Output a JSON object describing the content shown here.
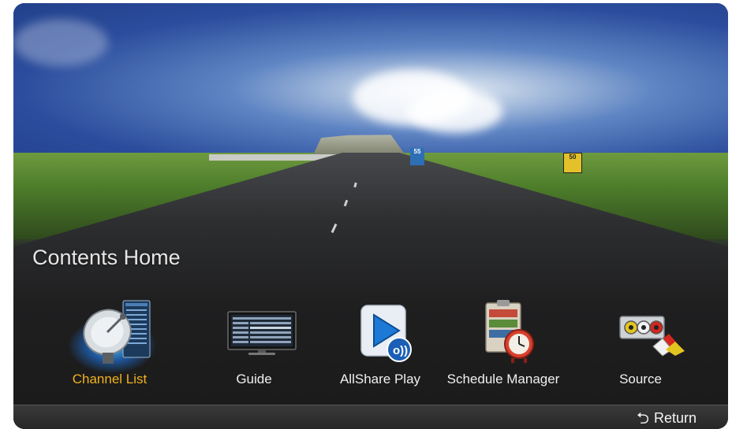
{
  "screen": {
    "title": "Contents Home"
  },
  "menu": {
    "items": [
      {
        "label": "Channel List",
        "icon": "satellite-dish-icon",
        "selected": true
      },
      {
        "label": "Guide",
        "icon": "tv-guide-icon",
        "selected": false
      },
      {
        "label": "AllShare Play",
        "icon": "allshare-play-icon",
        "selected": false
      },
      {
        "label": "Schedule Manager",
        "icon": "schedule-clock-icon",
        "selected": false
      },
      {
        "label": "Source",
        "icon": "av-source-icon",
        "selected": false
      }
    ]
  },
  "scene": {
    "exit_sign": "55",
    "speed_sign": "50"
  },
  "footer": {
    "return_label": "Return",
    "return_icon": "return-arrow-icon"
  },
  "colors": {
    "selected_text": "#f0b21e",
    "normal_text": "#f0f0f0",
    "highlight_glow": "#50beff"
  }
}
